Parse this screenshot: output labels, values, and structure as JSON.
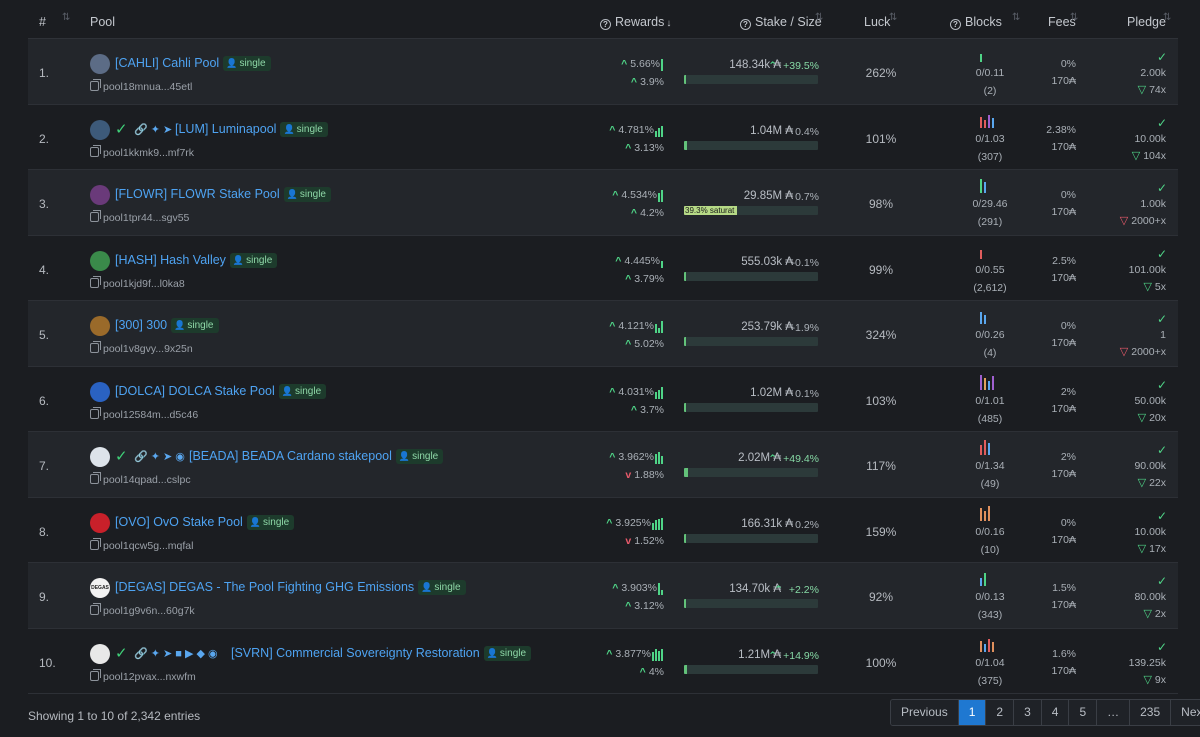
{
  "header": {
    "rank": "#",
    "pool": "Pool",
    "rewards": "Rewards",
    "stake": "Stake / Size",
    "luck": "Luck",
    "blocks": "Blocks",
    "fees": "Fees",
    "pledge": "Pledge"
  },
  "rows": [
    {
      "rank": "1.",
      "name": "[CAHLI] Cahli Pool",
      "badge": "single",
      "id": "pool18mnua...45etl",
      "verified": false,
      "socials": "",
      "r1": "5.66%",
      "r2": "3.9%",
      "r2dir": "up",
      "stake": "148.34k ₳",
      "delta": "+39.5%",
      "deltaPos": true,
      "fill": 0.005,
      "luck": "262%",
      "blk1": "0/0.11",
      "blk2": "(2)",
      "fee1": "0%",
      "fee2": "170₳",
      "pl1": "2.00k",
      "pl2": "74x",
      "pl2dir": "ok",
      "logo": "#5c6c86",
      "bars": [
        "#4fd487"
      ]
    },
    {
      "rank": "2.",
      "name": "[LUM] Luminapool",
      "badge": "single",
      "id": "pool1kkmk9...mf7rk",
      "verified": true,
      "socials": "🔗 ✦ ➤",
      "r1": "4.781%",
      "r2": "3.13%",
      "r2dir": "up",
      "stake": "1.04M ₳",
      "delta": "0.4%",
      "deltaPos": false,
      "fill": 0.02,
      "luck": "101%",
      "blk1": "0/1.03",
      "blk2": "(307)",
      "fee1": "2.38%",
      "fee2": "170₳",
      "pl1": "10.00k",
      "pl2": "104x",
      "pl2dir": "ok",
      "logo": "#3d5a7a",
      "bars": [
        "#e05d5d",
        "#e05d5d",
        "#a060d0",
        "#5aa7ef"
      ]
    },
    {
      "rank": "3.",
      "name": "[FLOWR] FLOWR Stake Pool",
      "badge": "single",
      "id": "pool1tpr44...sgv55",
      "verified": false,
      "socials": "",
      "r1": "4.534%",
      "r2": "4.2%",
      "r2dir": "up",
      "stake": "29.85M ₳",
      "delta": "0.7%",
      "deltaPos": false,
      "fill": 0.393,
      "satText": "39.3% saturat",
      "luck": "98%",
      "blk1": "0/29.46",
      "blk2": "(291)",
      "fee1": "0%",
      "fee2": "170₳",
      "pl1": "1.00k",
      "pl2": "2000+x",
      "pl2dir": "bad",
      "logo": "#6a3a7a",
      "bars": [
        "#4fd487",
        "#5aa7ef"
      ]
    },
    {
      "rank": "4.",
      "name": "[HASH] Hash Valley",
      "badge": "single",
      "id": "pool1kjd9f...l0ka8",
      "verified": false,
      "socials": "",
      "r1": "4.445%",
      "r2": "3.79%",
      "r2dir": "up",
      "stake": "555.03k ₳",
      "delta": "-0.1%",
      "deltaPos": false,
      "fill": 0.005,
      "luck": "99%",
      "blk1": "0/0.55",
      "blk2": "(2,612)",
      "fee1": "2.5%",
      "fee2": "170₳",
      "pl1": "101.00k",
      "pl2": "5x",
      "pl2dir": "ok",
      "logo": "#3a8a4a",
      "bars": [
        "#e05d5d"
      ]
    },
    {
      "rank": "5.",
      "name": "[300] 300",
      "badge": "single",
      "id": "pool1v8gvy...9x25n",
      "verified": false,
      "socials": "",
      "r1": "4.121%",
      "r2": "5.02%",
      "r2dir": "up",
      "stake": "253.79k ₳",
      "delta": "-1.9%",
      "deltaPos": false,
      "fill": 0.005,
      "luck": "324%",
      "blk1": "0/0.26",
      "blk2": "(4)",
      "fee1": "0%",
      "fee2": "170₳",
      "pl1": "1",
      "pl2": "2000+x",
      "pl2dir": "bad",
      "logo": "#9a6a2a",
      "bars": [
        "#5aa7ef",
        "#5aa7ef"
      ]
    },
    {
      "rank": "6.",
      "name": "[DOLCA] DOLCA Stake Pool",
      "badge": "single",
      "id": "pool12584m...d5c46",
      "verified": false,
      "socials": "",
      "r1": "4.031%",
      "r2": "3.7%",
      "r2dir": "up",
      "stake": "1.02M ₳",
      "delta": "0.1%",
      "deltaPos": false,
      "fill": 0.005,
      "luck": "103%",
      "blk1": "0/1.01",
      "blk2": "(485)",
      "fee1": "2%",
      "fee2": "170₳",
      "pl1": "50.00k",
      "pl2": "20x",
      "pl2dir": "ok",
      "logo": "#2a62c2",
      "bars": [
        "#a060d0",
        "#e0a05d",
        "#5aa7ef",
        "#a060d0"
      ]
    },
    {
      "rank": "7.",
      "name": "[BEADA] BEADA Cardano stakepool",
      "badge": "single",
      "id": "pool14qpad...cslpc",
      "verified": true,
      "socials": "🔗 ✦ ➤ ◉",
      "r1": "3.962%",
      "r2": "1.88%",
      "r2dir": "down",
      "stake": "2.02M ₳",
      "delta": "+49.4%",
      "deltaPos": true,
      "fill": 0.03,
      "luck": "117%",
      "blk1": "0/1.34",
      "blk2": "(49)",
      "fee1": "2%",
      "fee2": "170₳",
      "pl1": "90.00k",
      "pl2": "22x",
      "pl2dir": "ok",
      "logo": "#dde3ea",
      "bars": [
        "#e05d5d",
        "#e05d5d",
        "#5aa7ef"
      ]
    },
    {
      "rank": "8.",
      "name": "[OVO] OvO Stake Pool",
      "badge": "single",
      "id": "pool1qcw5g...mqfal",
      "verified": false,
      "socials": "",
      "r1": "3.925%",
      "r2": "1.52%",
      "r2dir": "down",
      "stake": "166.31k ₳",
      "delta": "0.2%",
      "deltaPos": false,
      "fill": 0.005,
      "luck": "159%",
      "blk1": "0/0.16",
      "blk2": "(10)",
      "fee1": "0%",
      "fee2": "170₳",
      "pl1": "10.00k",
      "pl2": "17x",
      "pl2dir": "ok",
      "logo": "#c8202a",
      "bars": [
        "#e0905d",
        "#e0905d",
        "#e0905d"
      ]
    },
    {
      "rank": "9.",
      "name": "[DEGAS] DEGAS - The Pool Fighting GHG Emissions",
      "badge": "single",
      "id": "pool1g9v6n...60g7k",
      "verified": false,
      "socials": "",
      "r1": "3.903%",
      "r2": "3.12%",
      "r2dir": "up",
      "stake": "134.70k ₳",
      "delta": "+2.2%",
      "deltaPos": true,
      "fill": 0.005,
      "luck": "92%",
      "blk1": "0/0.13",
      "blk2": "(343)",
      "fee1": "1.5%",
      "fee2": "170₳",
      "pl1": "80.00k",
      "pl2": "2x",
      "pl2dir": "ok",
      "logo": "#f2f2f2",
      "logoText": "DEGAS",
      "bars": [
        "#5aa7ef",
        "#4fd487"
      ]
    },
    {
      "rank": "10.",
      "name": "[SVRN] Commercial Sovereignty Restoration",
      "badge": "single",
      "id": "pool12pvax...nxwfm",
      "verified": true,
      "socials": "🔗 ✦ ➤ ■ ▶ ◆ ◉",
      "r1": "3.877%",
      "r2": "4%",
      "r2dir": "up",
      "stake": "1.21M ₳",
      "delta": "+14.9%",
      "deltaPos": true,
      "fill": 0.02,
      "luck": "100%",
      "blk1": "0/1.04",
      "blk2": "(375)",
      "fee1": "1.6%",
      "fee2": "170₳",
      "pl1": "139.25k",
      "pl2": "9x",
      "pl2dir": "ok",
      "logo": "#e8e8e8",
      "bars": [
        "#e0905d",
        "#5aa7ef",
        "#e05d5d",
        "#e0905d"
      ]
    }
  ],
  "footer": {
    "entries": "Showing 1 to 10 of 2,342 entries",
    "prev": "Previous",
    "pages": [
      "1",
      "2",
      "3",
      "4",
      "5",
      "…",
      "235"
    ],
    "next": "Next"
  },
  "colors": {
    "accent": "#1f78d1",
    "link": "#4ea3f2",
    "up": "#4fd487",
    "down": "#e85a6b"
  }
}
